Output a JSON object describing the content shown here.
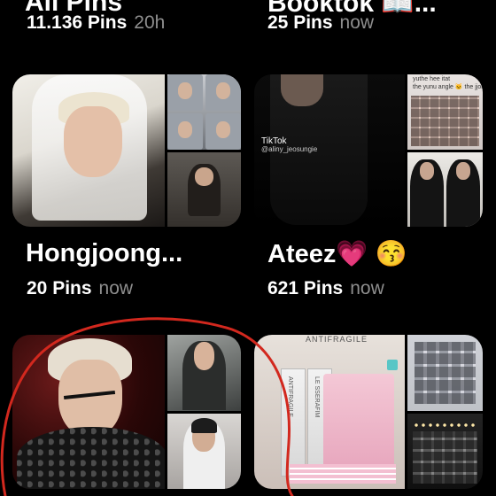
{
  "top_row": [
    {
      "title_cut": "All Pins",
      "count": "11.136 Pins",
      "age": "20h"
    },
    {
      "title_cut": "Booktok 📖...",
      "count": "25 Pins",
      "age": "now"
    }
  ],
  "boards": [
    {
      "title": "Hongjoong...",
      "count": "20 Pins",
      "age": "now"
    },
    {
      "title": "Ateez💗 😚",
      "count": "621 Pins",
      "age": "now",
      "watermark": {
        "app": "TikTok",
        "handle": "@aliny_jeosungie",
        "collage_label": "the yunu angle 🐱 the jjong angle",
        "top_label": "yuthe hee itat"
      }
    },
    {
      "title": "",
      "count": "",
      "age": ""
    },
    {
      "title": "",
      "count": "",
      "age": "",
      "book_text": {
        "cover": "ANTIFRAGILE",
        "spine1": "ANTIFRAGILE",
        "spine2": "LE SSERAFIM"
      }
    }
  ],
  "annotation": {
    "color": "#d2281e"
  }
}
